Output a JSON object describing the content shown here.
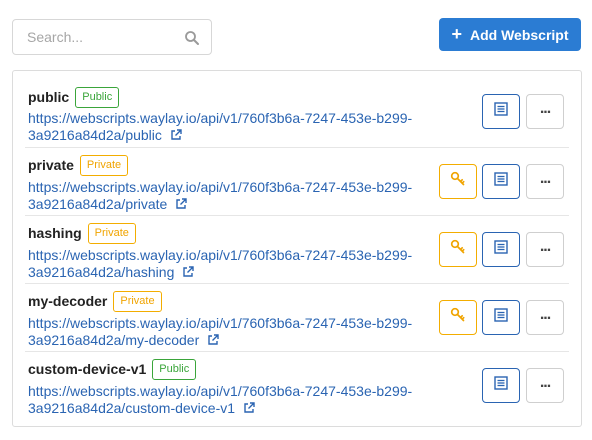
{
  "search": {
    "placeholder": "Search..."
  },
  "toolbar": {
    "add_label": "Add Webscript"
  },
  "colors": {
    "primary": "#2b7cd3",
    "link": "#2a64b2",
    "public": "#3aa53a",
    "private": "#f3ad00"
  },
  "webscripts": [
    {
      "name": "public",
      "visibility": "Public",
      "url_line1": "https://webscripts.waylay.io/api/v1/760f3b6a-7247-453e-b299-",
      "url_line2": "3a9216a84d2a/public"
    },
    {
      "name": "private",
      "visibility": "Private",
      "url_line1": "https://webscripts.waylay.io/api/v1/760f3b6a-7247-453e-b299-",
      "url_line2": "3a9216a84d2a/private"
    },
    {
      "name": "hashing",
      "visibility": "Private",
      "url_line1": "https://webscripts.waylay.io/api/v1/760f3b6a-7247-453e-b299-",
      "url_line2": "3a9216a84d2a/hashing"
    },
    {
      "name": "my-decoder",
      "visibility": "Private",
      "url_line1": "https://webscripts.waylay.io/api/v1/760f3b6a-7247-453e-b299-",
      "url_line2": "3a9216a84d2a/my-decoder"
    },
    {
      "name": "custom-device-v1",
      "visibility": "Public",
      "url_line1": "https://webscripts.waylay.io/api/v1/760f3b6a-7247-453e-b299-",
      "url_line2": "3a9216a84d2a/custom-device-v1"
    }
  ],
  "icons": {
    "search": "search-icon",
    "add": "plus-icon",
    "external": "external-link-icon",
    "key": "key-icon",
    "doc": "document-icon",
    "more": "more-icon"
  }
}
